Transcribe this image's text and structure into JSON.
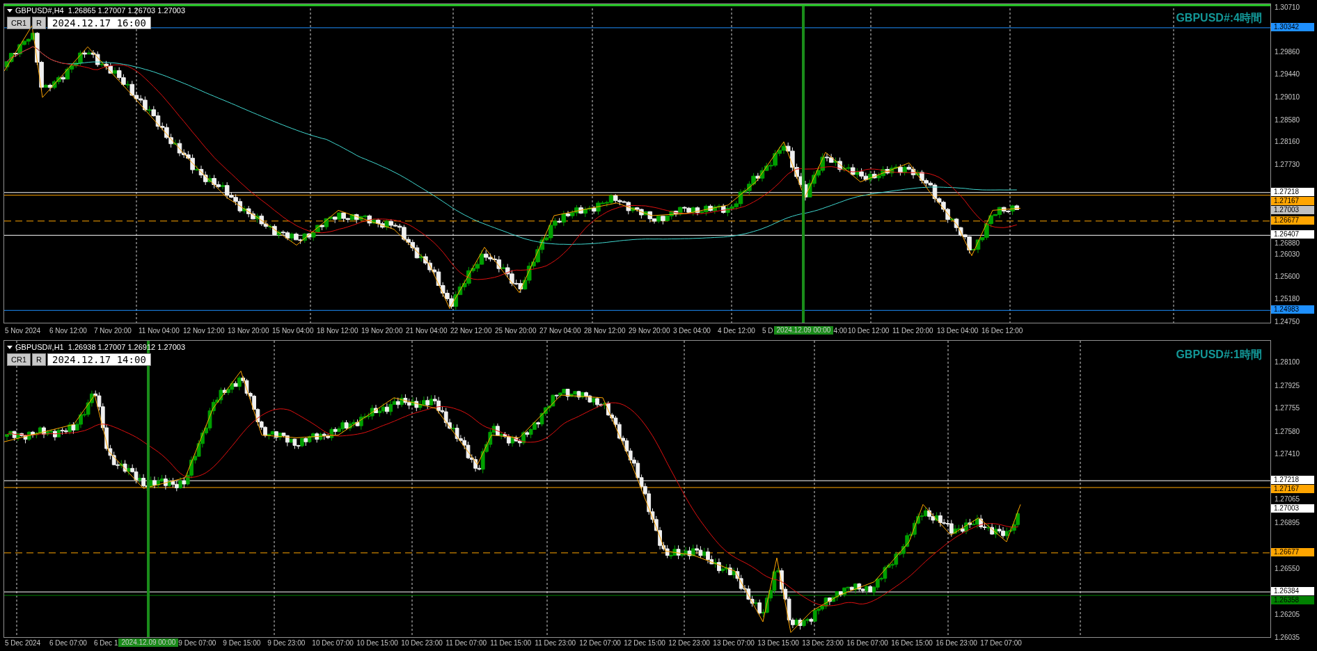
{
  "charts": [
    {
      "active": true,
      "header": {
        "symbol_line": "GBPUSD#,H4  1.26865 1.27007 1.26703 1.27003",
        "buttons": [
          "CR1",
          "R"
        ],
        "date_field": "2024.12.17 16:00"
      },
      "corner_label": "GBPUSD#:4時間",
      "price_ticks": [
        "1.30710",
        "1.29860",
        "1.29440",
        "1.29010",
        "1.28580",
        "1.28160",
        "1.27730",
        "1.26880",
        "1.26030",
        "1.25600",
        "1.25180",
        "1.24750"
      ],
      "price_tags": [
        {
          "text": "1.30342",
          "color": "#1e90ff",
          "kind": "solid"
        },
        {
          "text": "1.27218",
          "color": "#ffffff",
          "kind": "solid"
        },
        {
          "text": "1.27167",
          "color": "#ffa500",
          "kind": "solid"
        },
        {
          "text": "1.27003",
          "color": "#c0c0c0",
          "kind": "none"
        },
        {
          "text": "1.26677",
          "color": "#ffa500",
          "kind": "dashed"
        },
        {
          "text": "1.26407",
          "color": "#ffffff",
          "kind": "solid"
        },
        {
          "text": "1.24983",
          "color": "#1e90ff",
          "kind": "solid"
        }
      ],
      "time_labels": [
        {
          "text": "5 Nov 2024",
          "kind": "label"
        },
        {
          "text": "6 Nov 12:00",
          "kind": "label"
        },
        {
          "text": "7 Nov 20:00",
          "kind": "label"
        },
        {
          "text": "11 Nov 04:00",
          "kind": "label"
        },
        {
          "text": "12 Nov 12:00",
          "kind": "label"
        },
        {
          "text": "13 Nov 20:00",
          "kind": "label"
        },
        {
          "text": "15 Nov 04:00",
          "kind": "label"
        },
        {
          "text": "18 Nov 12:00",
          "kind": "label"
        },
        {
          "text": "19 Nov 20:00",
          "kind": "label"
        },
        {
          "text": "21 Nov 04:00",
          "kind": "label"
        },
        {
          "text": "22 Nov 12:00",
          "kind": "label"
        },
        {
          "text": "25 Nov 20:00",
          "kind": "label"
        },
        {
          "text": "27 Nov 04:00",
          "kind": "label"
        },
        {
          "text": "28 Nov 12:00",
          "kind": "label"
        },
        {
          "text": "29 Nov 20:00",
          "kind": "label"
        },
        {
          "text": "3 Dec 04:00",
          "kind": "label"
        },
        {
          "text": "4 Dec 12:00",
          "kind": "label"
        },
        {
          "text": "5 D",
          "kind": "partial"
        },
        {
          "text": "2024.12.09 00:00",
          "kind": "marker"
        },
        {
          "text": "4:00",
          "kind": "partial"
        },
        {
          "text": "10 Dec 12:00",
          "kind": "label"
        },
        {
          "text": "11 Dec 20:00",
          "kind": "label"
        },
        {
          "text": "13 Dec 04:00",
          "kind": "label"
        },
        {
          "text": "16 Dec 12:00",
          "kind": "label"
        }
      ]
    },
    {
      "active": false,
      "header": {
        "symbol_line": "GBPUSD#,H1  1.26938 1.27007 1.26912 1.27003",
        "buttons": [
          "CR1",
          "R"
        ],
        "date_field": "2024.12.17 14:00"
      },
      "corner_label": "GBPUSD#:1時間",
      "price_ticks": [
        "1.28100",
        "1.27925",
        "1.27755",
        "1.27580",
        "1.27410",
        "1.27065",
        "1.26895",
        "1.26550",
        "1.26205",
        "1.26035"
      ],
      "price_tags": [
        {
          "text": "1.27218",
          "color": "#ffffff",
          "kind": "solid"
        },
        {
          "text": "1.27167",
          "color": "#ffa500",
          "kind": "solid"
        },
        {
          "text": "1.27003",
          "color": "#ffffff",
          "kind": "none"
        },
        {
          "text": "1.26677",
          "color": "#ffa500",
          "kind": "dashed"
        },
        {
          "text": "1.26384",
          "color": "#ffffff",
          "kind": "solid"
        },
        {
          "text": "1.26358",
          "color": "#008000",
          "kind": "solid"
        }
      ],
      "time_labels": [
        {
          "text": "5 Dec 2024",
          "kind": "label"
        },
        {
          "text": "6 Dec 07:00",
          "kind": "label"
        },
        {
          "text": "6 Dec 1",
          "kind": "partial"
        },
        {
          "text": "2024.12.09 00:00",
          "kind": "marker"
        },
        {
          "text": "9 Dec 07:00",
          "kind": "label"
        },
        {
          "text": "9 Dec 15:00",
          "kind": "label"
        },
        {
          "text": "9 Dec 23:00",
          "kind": "label"
        },
        {
          "text": "10 Dec 07:00",
          "kind": "label"
        },
        {
          "text": "10 Dec 15:00",
          "kind": "label"
        },
        {
          "text": "10 Dec 23:00",
          "kind": "label"
        },
        {
          "text": "11 Dec 07:00",
          "kind": "label"
        },
        {
          "text": "11 Dec 15:00",
          "kind": "label"
        },
        {
          "text": "11 Dec 23:00",
          "kind": "label"
        },
        {
          "text": "12 Dec 07:00",
          "kind": "label"
        },
        {
          "text": "12 Dec 15:00",
          "kind": "label"
        },
        {
          "text": "12 Dec 23:00",
          "kind": "label"
        },
        {
          "text": "13 Dec 07:00",
          "kind": "label"
        },
        {
          "text": "13 Dec 15:00",
          "kind": "label"
        },
        {
          "text": "13 Dec 23:00",
          "kind": "label"
        },
        {
          "text": "16 Dec 07:00",
          "kind": "label"
        },
        {
          "text": "16 Dec 15:00",
          "kind": "label"
        },
        {
          "text": "16 Dec 23:00",
          "kind": "label"
        },
        {
          "text": "17 Dec 07:00",
          "kind": "label"
        }
      ]
    }
  ]
}
